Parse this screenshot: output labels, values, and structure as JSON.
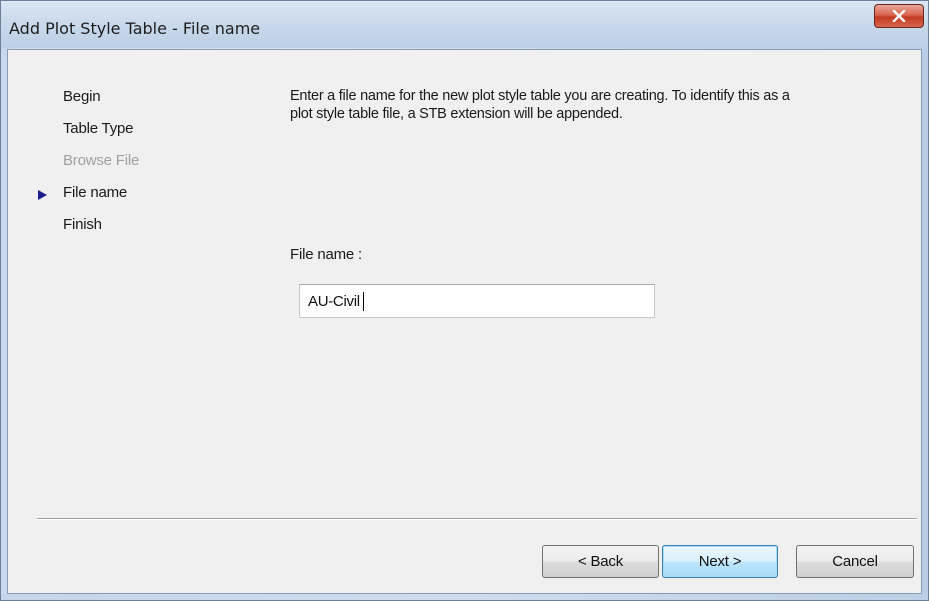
{
  "window": {
    "title": "Add Plot Style Table - File name",
    "close_icon": "close-icon"
  },
  "steps": [
    {
      "label": "Begin",
      "state": "done"
    },
    {
      "label": "Table Type",
      "state": "done"
    },
    {
      "label": "Browse File",
      "state": "disabled"
    },
    {
      "label": "File name",
      "state": "current"
    },
    {
      "label": "Finish",
      "state": "pending"
    }
  ],
  "current_step_icon": "triangle-right-icon",
  "instructions": "Enter a file name for the new plot style table you are creating. To identify this as a plot style table file, a STB extension will be appended.",
  "file_name_field": {
    "label": "File name :",
    "value": "AU-Civil"
  },
  "buttons": {
    "back": "< Back",
    "next": "Next >",
    "cancel": "Cancel"
  },
  "colors": {
    "current_step_marker": "#1c1c8c",
    "disabled_text": "#a0a0a0",
    "default_button_border": "#3c7fb1"
  }
}
